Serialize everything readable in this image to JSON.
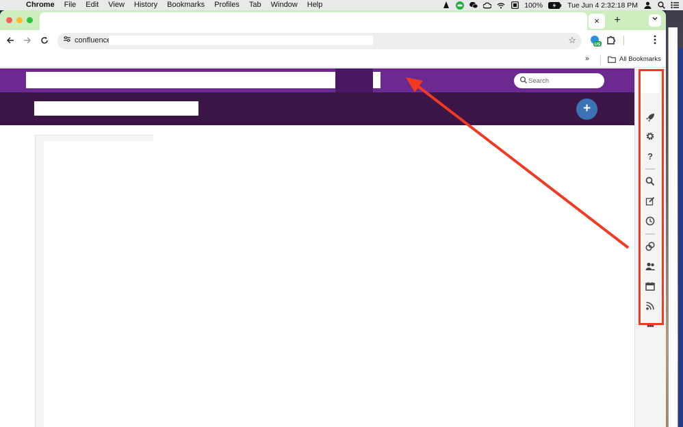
{
  "menubar": {
    "app": "Chrome",
    "items": [
      "File",
      "Edit",
      "View",
      "History",
      "Bookmarks",
      "Profiles",
      "Tab",
      "Window",
      "Help"
    ],
    "battery": "100%",
    "clock": "Tue Jun 4  2:32:18 PM"
  },
  "browser": {
    "tab_close": "×",
    "new_tab": "+",
    "url": "confluence",
    "bookmarks_more": "»",
    "all_bookmarks": "All Bookmarks",
    "extension_badge": "US"
  },
  "page": {
    "search_placeholder": "Search",
    "create_label": "+"
  },
  "sidebar": {
    "icons": [
      "rocket-icon",
      "gear-icon",
      "help-icon",
      "search-icon",
      "edit-icon",
      "clock-icon",
      "link-icon",
      "people-icon",
      "calendar-icon",
      "feed-icon",
      "more-icon"
    ],
    "more_label": "•••"
  },
  "colors": {
    "topnav": "#6c2a90",
    "space_header": "#3d1648",
    "create_button": "#3b73b4",
    "annotation": "#f03a22",
    "tab_strip": "#cfeec0"
  }
}
